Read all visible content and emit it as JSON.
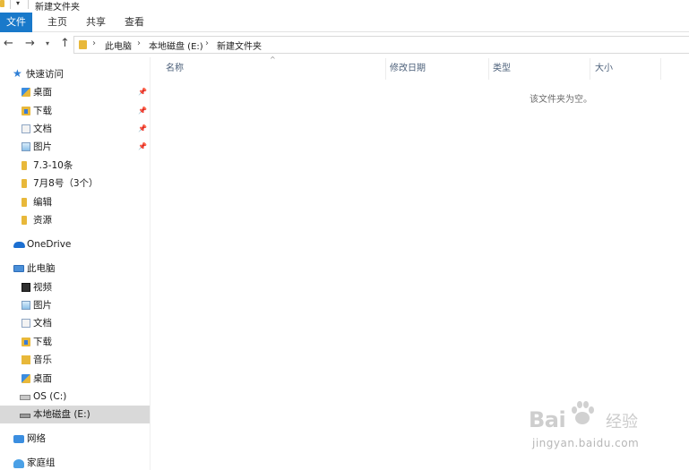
{
  "window": {
    "title": "新建文件夹",
    "quick_access_dropdown": "▾"
  },
  "ribbon": {
    "tabs": [
      "文件",
      "主页",
      "共享",
      "查看"
    ]
  },
  "navigation": {
    "back": "←",
    "forward": "→",
    "recent_dropdown": "▾",
    "up": "↑"
  },
  "address": {
    "separator": "›",
    "crumbs": [
      "此电脑",
      "本地磁盘 (E:)",
      "新建文件夹"
    ]
  },
  "sidebar": {
    "pin_glyph": "📌",
    "items": [
      {
        "label": "快速访问",
        "icon": "star-icon"
      },
      {
        "label": "桌面",
        "icon": "desktop-folder-icon",
        "pinned": true
      },
      {
        "label": "下载",
        "icon": "download-folder-icon",
        "pinned": true
      },
      {
        "label": "文档",
        "icon": "documents-icon",
        "pinned": true
      },
      {
        "label": "图片",
        "icon": "pictures-icon",
        "pinned": true
      },
      {
        "label": "7.3-10条",
        "icon": "folder-icon"
      },
      {
        "label": "7月8号（3个）",
        "icon": "folder-icon"
      },
      {
        "label": "编辑",
        "icon": "folder-icon"
      },
      {
        "label": "资源",
        "icon": "folder-icon"
      },
      {
        "label": "OneDrive",
        "icon": "onedrive-icon"
      },
      {
        "label": "此电脑",
        "icon": "this-pc-icon"
      },
      {
        "label": "视频",
        "icon": "videos-icon"
      },
      {
        "label": "图片",
        "icon": "pictures-icon"
      },
      {
        "label": "文档",
        "icon": "documents-icon"
      },
      {
        "label": "下载",
        "icon": "download-folder-icon"
      },
      {
        "label": "音乐",
        "icon": "music-icon"
      },
      {
        "label": "桌面",
        "icon": "desktop-folder-icon"
      },
      {
        "label": "OS (C:)",
        "icon": "drive-c-icon"
      },
      {
        "label": "本地磁盘 (E:)",
        "icon": "drive-e-icon",
        "selected": true
      },
      {
        "label": "网络",
        "icon": "network-icon"
      },
      {
        "label": "家庭组",
        "icon": "homegroup-icon"
      }
    ]
  },
  "file_list": {
    "sort_indicator": "^",
    "columns": [
      "名称",
      "修改日期",
      "类型",
      "大小"
    ],
    "empty_message": "该文件夹为空。"
  },
  "watermark": {
    "logo": "Bai",
    "logo_suffix": "经验",
    "url": "jingyan.baidu.com"
  },
  "colors": {
    "ribbon_file_tab": "#1979ca",
    "selected_row": "#d9d9d9",
    "folder": "#e8b83a"
  }
}
